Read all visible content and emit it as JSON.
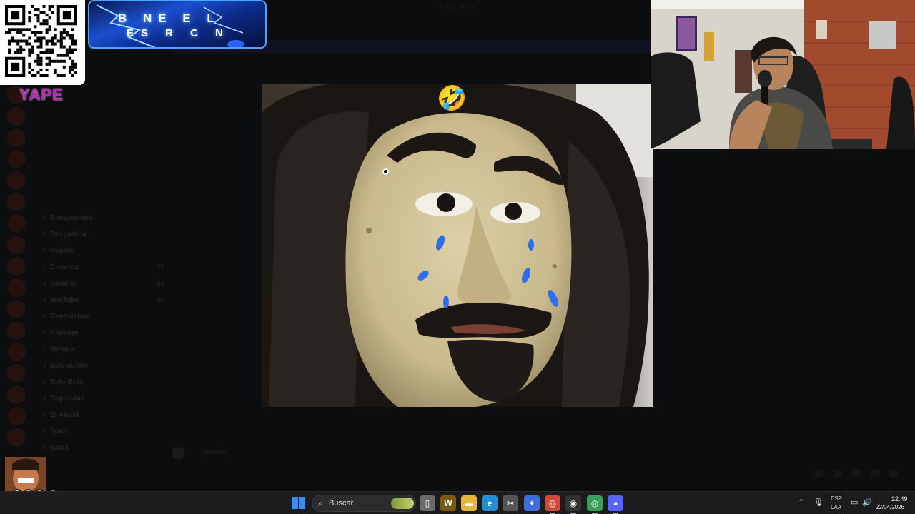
{
  "overlay": {
    "yape_label": "YAPE",
    "banner_line1": "B NE E L",
    "banner_line2": "ES R C N",
    "streamer_tag": "x2004",
    "mini_label": "ado"
  },
  "reaction": {
    "emoji": "🤣"
  },
  "dim_app": {
    "top_title": "# FOL AFON",
    "channels": [
      {
        "name": "Bienvenidos",
        "count": ""
      },
      {
        "name": "Despedida",
        "count": ""
      },
      {
        "name": "Reglas",
        "count": ""
      },
      {
        "name": "Directos",
        "count": "00"
      },
      {
        "name": "General",
        "count": "00"
      },
      {
        "name": "YouTube",
        "count": "00"
      },
      {
        "name": "Reacciones",
        "count": ""
      },
      {
        "name": "Akinator",
        "count": ""
      },
      {
        "name": "Música",
        "count": ""
      },
      {
        "name": "Evaluación",
        "count": ""
      },
      {
        "name": "Solo Bots",
        "count": ""
      },
      {
        "name": "Seguridad",
        "count": ""
      },
      {
        "name": "El Ataúd",
        "count": ""
      },
      {
        "name": "Spam",
        "count": ""
      },
      {
        "name": "Salas",
        "count": ""
      }
    ],
    "composer_user": "andvero"
  },
  "taskbar": {
    "search_placeholder": "Buscar",
    "apps": [
      {
        "icon": "file-explorer-icon",
        "glyph": "▯",
        "color": "#6a6a6a"
      },
      {
        "icon": "wow-icon",
        "glyph": "W",
        "color": "#7a5a10"
      },
      {
        "icon": "folder-icon",
        "glyph": "▬",
        "color": "#e7b53a"
      },
      {
        "icon": "edge-icon",
        "glyph": "e",
        "color": "#1f8fd6"
      },
      {
        "icon": "capture-icon",
        "glyph": "✂",
        "color": "#555"
      },
      {
        "icon": "copilot-icon",
        "glyph": "✦",
        "color": "#3f6de0"
      },
      {
        "icon": "chrome-icon",
        "glyph": "◎",
        "color": "#d04a3a"
      },
      {
        "icon": "obs-icon",
        "glyph": "◉",
        "color": "#333"
      },
      {
        "icon": "chrome-profile-icon",
        "glyph": "◎",
        "color": "#3aa05a"
      },
      {
        "icon": "discord-icon",
        "glyph": "◕",
        "color": "#5865f2"
      }
    ],
    "lang_line1": "ESP",
    "lang_line2": "LAA",
    "clock_time": "22:49",
    "clock_date": "22/04/2026"
  }
}
